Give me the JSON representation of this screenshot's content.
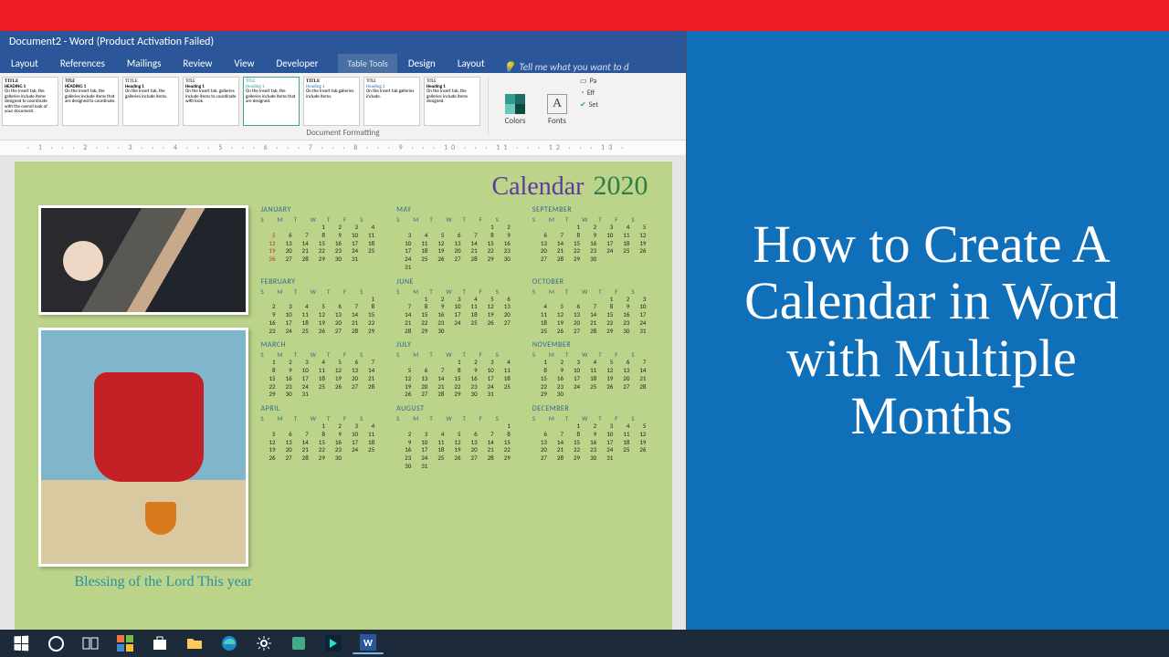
{
  "overlay": {
    "title": "How to Create A Calendar in Word with Multiple Months"
  },
  "window": {
    "title": "Document2 - Word (Product Activation Failed)",
    "table_tools": "Table Tools",
    "tabs": [
      "Layout",
      "References",
      "Mailings",
      "Review",
      "View",
      "Developer",
      "Design",
      "Layout"
    ],
    "tellme": "Tell me what you want to d",
    "group_label": "Document Formatting",
    "ruler": "· 1 · · · 2 · · · 3 · · · 4 · · · 5 · · · 6 · · · 7 · · · 8 · · · 9 · · · 10 · · · 11 · · · 12 · · · 13 ·",
    "ribbon_btn_colors": "Colors",
    "ribbon_btn_fonts": "Fonts",
    "misc": [
      "Pa",
      "Eff",
      "Set"
    ],
    "style_title": "TITLE",
    "style_heading": "HEADING 1",
    "style_heading2": "Heading 1"
  },
  "calendar": {
    "word": "Calendar",
    "year": "2020",
    "blessing": "Blessing of the Lord This year",
    "dow": [
      "S",
      "M",
      "T",
      "W",
      "T",
      "F",
      "S"
    ],
    "months": [
      {
        "name": "JANUARY",
        "offset": 3,
        "days": 31,
        "sun_col": true
      },
      {
        "name": "MAY",
        "offset": 5,
        "days": 31
      },
      {
        "name": "SEPTEMBER",
        "offset": 2,
        "days": 30
      },
      {
        "name": "FEBRUARY",
        "offset": 6,
        "days": 29
      },
      {
        "name": "JUNE",
        "offset": 1,
        "days": 30
      },
      {
        "name": "OCTOBER",
        "offset": 4,
        "days": 31
      },
      {
        "name": "MARCH",
        "offset": 0,
        "days": 31
      },
      {
        "name": "JULY",
        "offset": 3,
        "days": 31
      },
      {
        "name": "NOVEMBER",
        "offset": 0,
        "days": 30
      },
      {
        "name": "APRIL",
        "offset": 3,
        "days": 30
      },
      {
        "name": "AUGUST",
        "offset": 6,
        "days": 31
      },
      {
        "name": "DECEMBER",
        "offset": 2,
        "days": 31
      }
    ]
  },
  "taskbar": {
    "items": [
      "start",
      "cortana",
      "task-view",
      "pinned",
      "store",
      "file-explorer",
      "edge",
      "settings",
      "skype",
      "filmora",
      "word"
    ]
  }
}
